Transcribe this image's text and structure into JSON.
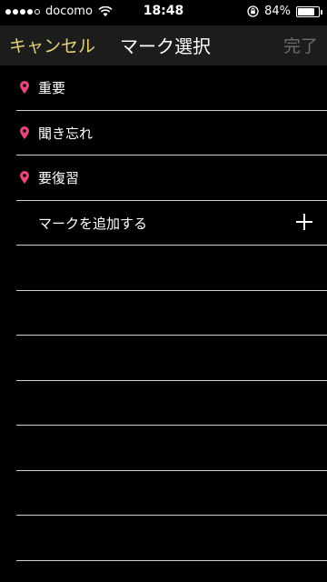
{
  "status_bar": {
    "carrier": "docomo",
    "time": "18:48",
    "battery_percent": "84%",
    "battery_level": 0.84,
    "signal_dots_filled": 4,
    "signal_dots_total": 5
  },
  "nav": {
    "cancel_label": "キャンセル",
    "title": "マーク選択",
    "done_label": "完了"
  },
  "marks": [
    {
      "label": "重要",
      "icon": "pin-icon"
    },
    {
      "label": "聞き忘れ",
      "icon": "pin-icon"
    },
    {
      "label": "要復習",
      "icon": "pin-icon"
    }
  ],
  "add_mark": {
    "label": "マークを追加する",
    "icon": "plus-icon"
  },
  "colors": {
    "accent_cancel": "#e3d07a",
    "done_disabled": "#6b6b6b",
    "pin": "#e8457a",
    "background": "#000000",
    "nav_background": "#1c1c1c"
  }
}
